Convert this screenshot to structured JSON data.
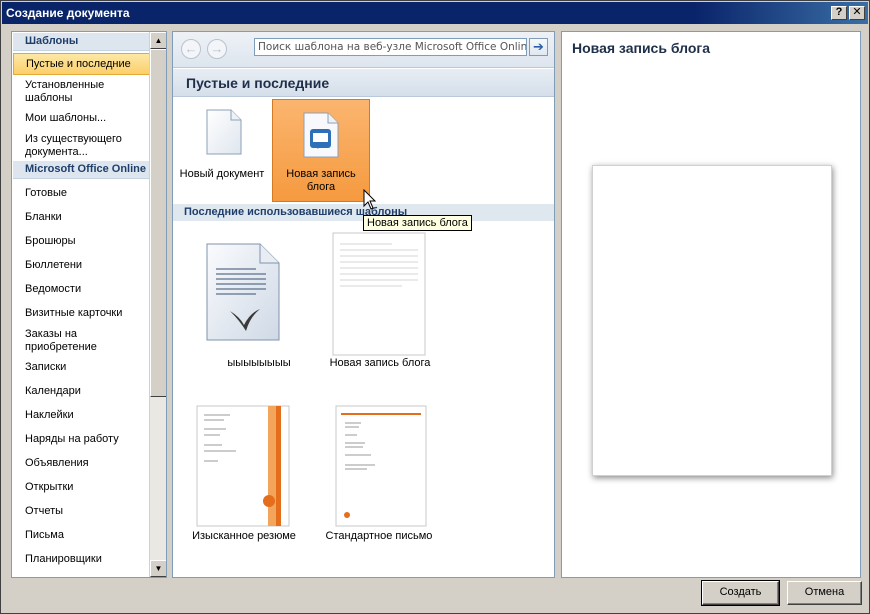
{
  "window": {
    "title": "Создание документа",
    "help_label": "?",
    "close_label": "✕"
  },
  "sidebar": {
    "sections": [
      {
        "label": "Шаблоны"
      },
      {
        "label": "Microsoft Office Online"
      }
    ],
    "items": [
      {
        "label": "Пустые и последние",
        "selected": true
      },
      {
        "label": "Установленные шаблоны"
      },
      {
        "label": "Мои шаблоны..."
      },
      {
        "label": "Из существующего документа..."
      },
      {
        "label": "Готовые"
      },
      {
        "label": "Бланки"
      },
      {
        "label": "Брошюры"
      },
      {
        "label": "Бюллетени"
      },
      {
        "label": "Ведомости"
      },
      {
        "label": "Визитные карточки"
      },
      {
        "label": "Заказы на приобретение"
      },
      {
        "label": "Записки"
      },
      {
        "label": "Календари"
      },
      {
        "label": "Наклейки"
      },
      {
        "label": "Наряды на работу"
      },
      {
        "label": "Объявления"
      },
      {
        "label": "Открытки"
      },
      {
        "label": "Отчеты"
      },
      {
        "label": "Письма"
      },
      {
        "label": "Планировщики"
      }
    ]
  },
  "toolbar": {
    "back_icon": "arrow-left-icon",
    "forward_icon": "arrow-right-icon",
    "search_placeholder": "Поиск шаблона на веб-узле Microsoft Office Online",
    "search_go_icon": "arrow-right-icon"
  },
  "main": {
    "header": "Пустые и последние",
    "blank_tiles": [
      {
        "label": "Новый документ",
        "icon": "blank-document-icon"
      },
      {
        "label": "Новая запись блога",
        "icon": "blog-post-icon",
        "selected": true
      }
    ],
    "recent_header": "Последние использовавшиеся шаблоны",
    "recent_tiles": [
      {
        "label": "ыыыыыыыы",
        "icon": "word-document-icon"
      },
      {
        "label": "Новая запись блога",
        "icon": "blog-template-thumbnail"
      },
      {
        "label": "Изысканное резюме",
        "icon": "resume-template-thumbnail"
      },
      {
        "label": "Стандартное письмо",
        "icon": "letter-template-thumbnail"
      }
    ],
    "tooltip": "Новая запись блога"
  },
  "preview": {
    "title": "Новая запись блога"
  },
  "buttons": {
    "create": "Создать",
    "cancel": "Отмена"
  },
  "colors": {
    "title_bar": "#0a246a",
    "selected_tile": "#f59a3f",
    "selected_nav": "#fbcf6a",
    "section_bg": "#dde5ee"
  }
}
